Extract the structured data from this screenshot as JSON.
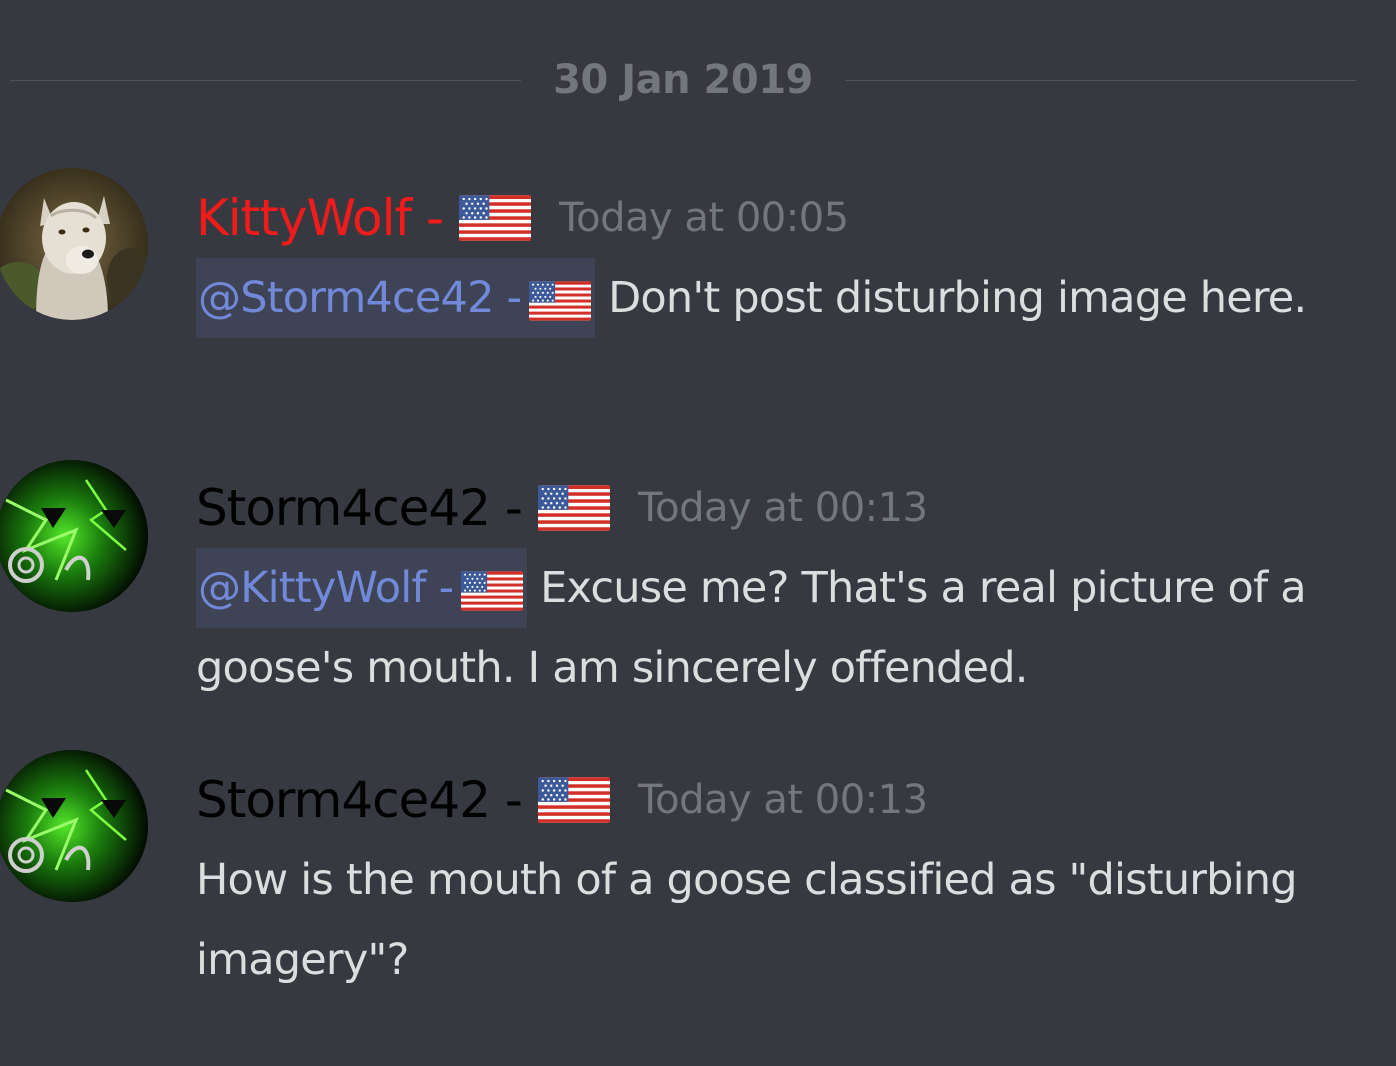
{
  "date_divider": "30 Jan 2019",
  "messages": [
    {
      "avatar": "wolf-avatar",
      "author": "KittyWolf -",
      "author_color": "#f21b1b",
      "flag": "us-flag",
      "timestamp": "Today at 00:05",
      "mention": "@Storm4ce42 -",
      "text": " Don't post disturbing image here."
    },
    {
      "avatar": "green-abstract-avatar",
      "author": "Storm4ce42 -",
      "author_color": "#000000",
      "flag": "us-flag",
      "timestamp": "Today at 00:13",
      "mention": "@KittyWolf -",
      "text": " Excuse me? That's a real picture of a goose's mouth. I am sincerely offended."
    },
    {
      "avatar": "green-abstract-avatar",
      "author": "Storm4ce42 -",
      "author_color": "#000000",
      "flag": "us-flag",
      "timestamp": "Today at 00:13",
      "text": "How is the mouth of a goose classified as \"disturbing imagery\"?"
    }
  ],
  "colors": {
    "background": "#36393f",
    "mention_bg": "#3e4456",
    "mention_text": "#7289da",
    "message_text": "#dcddde",
    "timestamp": "#72767d"
  }
}
